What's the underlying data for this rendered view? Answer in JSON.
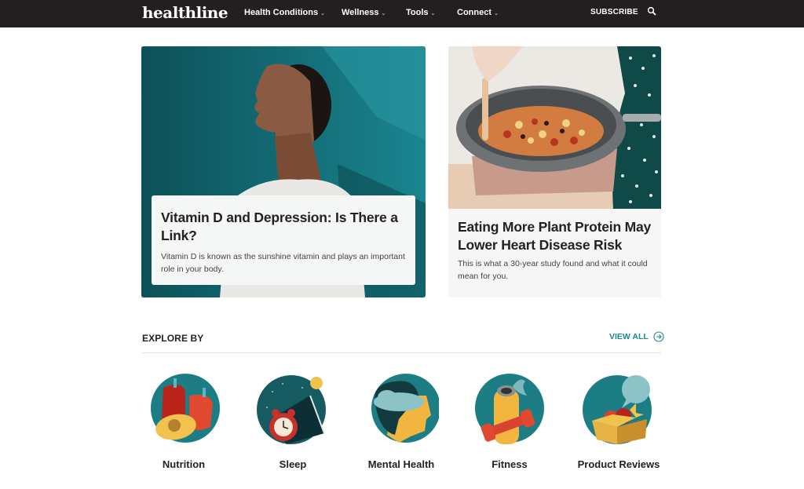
{
  "header": {
    "logo": "healthline",
    "nav": [
      {
        "label": "Health Conditions",
        "icon": "chevron-down-icon"
      },
      {
        "label": "Wellness",
        "icon": "chevron-down-icon"
      },
      {
        "label": "Tools",
        "icon": "chevron-down-icon"
      },
      {
        "label": "Connect",
        "icon": "chevron-down-icon"
      }
    ],
    "subscribe_label": "SUBSCRIBE",
    "search_icon": "search-icon"
  },
  "featured": [
    {
      "title": "Vitamin D and Depression: Is There a Link?",
      "description": "Vitamin D is known as the sunshine vitamin and plays an important role in your body.",
      "image": "woman-in-sunlight-photo"
    },
    {
      "title": "Eating More Plant Protein May Lower Heart Disease Risk",
      "description": "This is what a 30-year study found and what it could mean for you.",
      "image": "vegetable-stir-fry-pan-photo"
    }
  ],
  "explore": {
    "heading": "EXPLORE BY",
    "view_all_label": "VIEW ALL",
    "view_all_icon": "arrow-right-circle-icon",
    "categories": [
      {
        "label": "Nutrition",
        "icon": "nutrition-icon"
      },
      {
        "label": "Sleep",
        "icon": "sleep-icon"
      },
      {
        "label": "Mental Health",
        "icon": "mental-health-icon"
      },
      {
        "label": "Fitness",
        "icon": "fitness-icon"
      },
      {
        "label": "Product Reviews",
        "icon": "product-reviews-icon"
      }
    ]
  },
  "colors": {
    "header_bg": "#231f20",
    "accent": "#1a8a8a",
    "icon_teal": "#1d7d84"
  }
}
